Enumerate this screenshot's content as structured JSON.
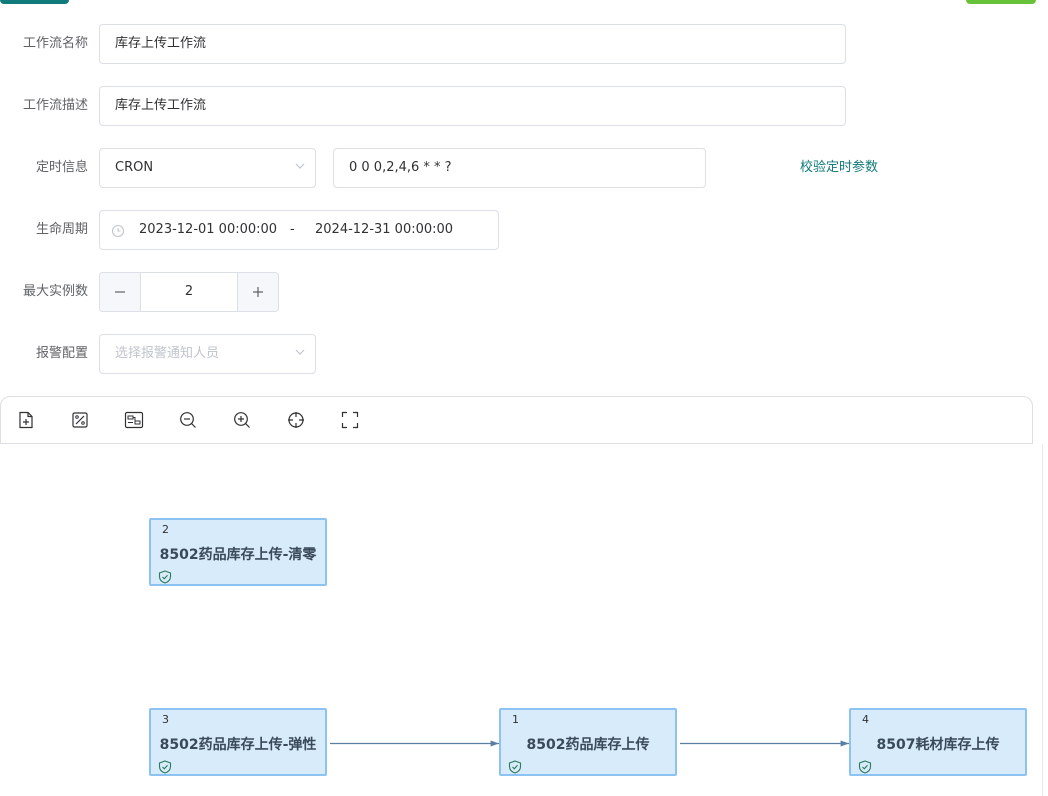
{
  "form": {
    "name": {
      "label": "工作流名称",
      "value": "库存上传工作流"
    },
    "desc": {
      "label": "工作流描述",
      "value": "库存上传工作流"
    },
    "schedule": {
      "label": "定时信息",
      "type": "CRON",
      "cron": "0 0 0,2,4,6 * * ?",
      "validate_link": "校验定时参数"
    },
    "lifecycle": {
      "label": "生命周期",
      "start": "2023-12-01 00:00:00",
      "separator": "-",
      "end": "2024-12-31 00:00:00"
    },
    "max_instances": {
      "label": "最大实例数",
      "value": "2"
    },
    "alarm": {
      "label": "报警配置",
      "placeholder": "选择报警通知人员"
    }
  },
  "toolbar": {
    "items": [
      "add-file-icon",
      "percent-icon",
      "layout-icon",
      "zoom-out-icon",
      "zoom-in-icon",
      "locate-icon",
      "fullscreen-icon"
    ]
  },
  "graph": {
    "nodes": [
      {
        "id": "2",
        "title": "8502药品库存上传-清零"
      },
      {
        "id": "3",
        "title": "8502药品库存上传-弹性"
      },
      {
        "id": "1",
        "title": "8502药品库存上传"
      },
      {
        "id": "4",
        "title": "8507耗材库存上传"
      }
    ]
  },
  "colors": {
    "accent": "#117a7a",
    "success": "#67c23a",
    "node_fill": "#d7ebfb",
    "node_border": "#8cc3f2",
    "edge": "#5b7fa3"
  }
}
